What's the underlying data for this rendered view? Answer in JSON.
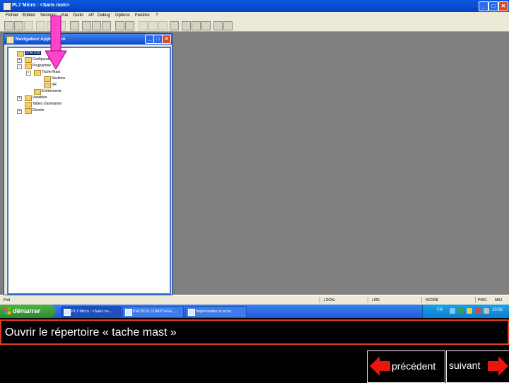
{
  "window": {
    "title": "PL7 Micro : <Sans nom>",
    "min_glyph": "_",
    "max_glyph": "□",
    "close_glyph": "✕"
  },
  "menu": [
    "Fichier",
    "Edition",
    "Services",
    "Vue",
    "Outils",
    "AP",
    "Debug",
    "Options",
    "Fenêtre",
    "?"
  ],
  "navigator": {
    "title": "Navigateur Application",
    "tree": [
      {
        "label": "STATION",
        "selected": true
      },
      {
        "label": "Configuration"
      },
      {
        "label": "Programme"
      },
      {
        "label": "Tâche Mast"
      },
      {
        "label": "Sections"
      },
      {
        "label": "SR"
      },
      {
        "label": "Evénements"
      },
      {
        "label": "Variables"
      },
      {
        "label": "Tables d'animation"
      },
      {
        "label": "Dossier"
      }
    ]
  },
  "statusbar": {
    "left": "Prêt",
    "items": [
      "LOCAL",
      "LIRE",
      "NCORE",
      "PRE1",
      "MAJ"
    ]
  },
  "taskbar": {
    "start_label": "démarrer",
    "tasks": [
      "PL7 Micro : <Sans no...",
      "PHOTOS COMPTAGE ...",
      "Imprimantes et acce..."
    ],
    "tray_lang": "FR",
    "clock": "10:05"
  },
  "caption": "Ouvrir le répertoire « tache mast »",
  "nav": {
    "prev_label": "précédent",
    "next_label": "suivant"
  },
  "colors": {
    "caption_border": "#e03a1c",
    "arrow": "#ff44cc",
    "nav_arrow": "#e8160c"
  }
}
